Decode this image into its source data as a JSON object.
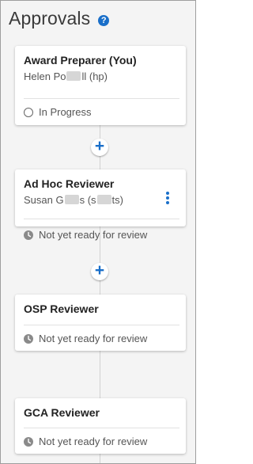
{
  "header": {
    "title": "Approvals",
    "help_icon": "question-circle-icon",
    "help_glyph": "?"
  },
  "add_glyph": "+",
  "colors": {
    "accent": "#1a6fc9",
    "panel_background": "#f4f4f4",
    "card_background": "#ffffff",
    "connector": "#d2d2d2"
  },
  "approvers": [
    {
      "role": "Award Preparer (You)",
      "person_first": "Helen Po",
      "person_rest": "ll (hp)",
      "status": "In Progress",
      "status_icon": "circle-outline-icon"
    },
    {
      "role": "Ad Hoc Reviewer",
      "person_first": "Susan G",
      "person_mid": "s (s",
      "person_rest": "ts)",
      "status": "Not yet ready for review",
      "status_icon": "clock-icon",
      "menu_icon": "kebab-menu-icon"
    },
    {
      "role": "OSP Reviewer",
      "status": "Not yet ready for review",
      "status_icon": "clock-icon"
    },
    {
      "role": "GCA Reviewer",
      "status": "Not yet ready for review",
      "status_icon": "clock-icon"
    }
  ]
}
